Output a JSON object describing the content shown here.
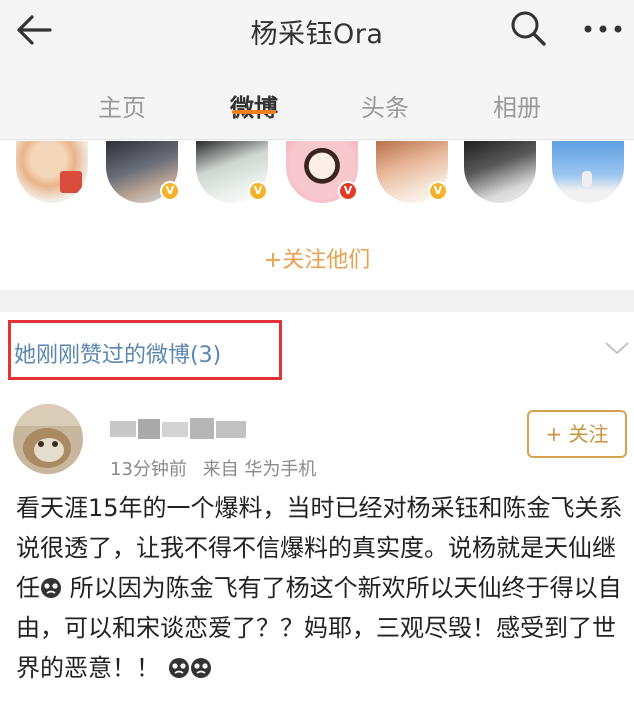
{
  "header": {
    "title": "杨采钰Ora",
    "back_icon": "back-arrow-icon",
    "search_icon": "search-icon",
    "more_icon": "more-dots-icon"
  },
  "tabs": [
    {
      "label": "主页",
      "active": false
    },
    {
      "label": "微博",
      "active": true
    },
    {
      "label": "头条",
      "active": false
    },
    {
      "label": "相册",
      "active": false
    }
  ],
  "colors": {
    "accent": "#f2801f",
    "follow_text": "#e8a14c",
    "link_blue": "#5a86b0",
    "highlight_box": "#e33238",
    "verified_gold": "#f5b32a",
    "verified_red": "#e03c23"
  },
  "followed_users": {
    "follow_all_label": "+关注他们",
    "verified_badge_text": "V"
  },
  "liked": {
    "title": "她刚刚赞过的微博(3)",
    "expand_icon": "chevron-down-icon"
  },
  "post": {
    "time": "13分钟前",
    "source": "来自 华为手机",
    "follow_label": "+ 关注",
    "text_part1": "看天涯15年的一个爆料，当时已经对杨采钰和陈金飞关系说很透了，让我不得不信爆料的真实度。说杨就是天仙继任",
    "text_part2": " 所以因为陈金飞有了杨这个新欢所以天仙终于得以自由，可以和宋谈恋爱了？？妈耶，三观尽毁！感受到了世界的恶意！！",
    "emoji_icon": "sad-face-emoji-icon"
  }
}
